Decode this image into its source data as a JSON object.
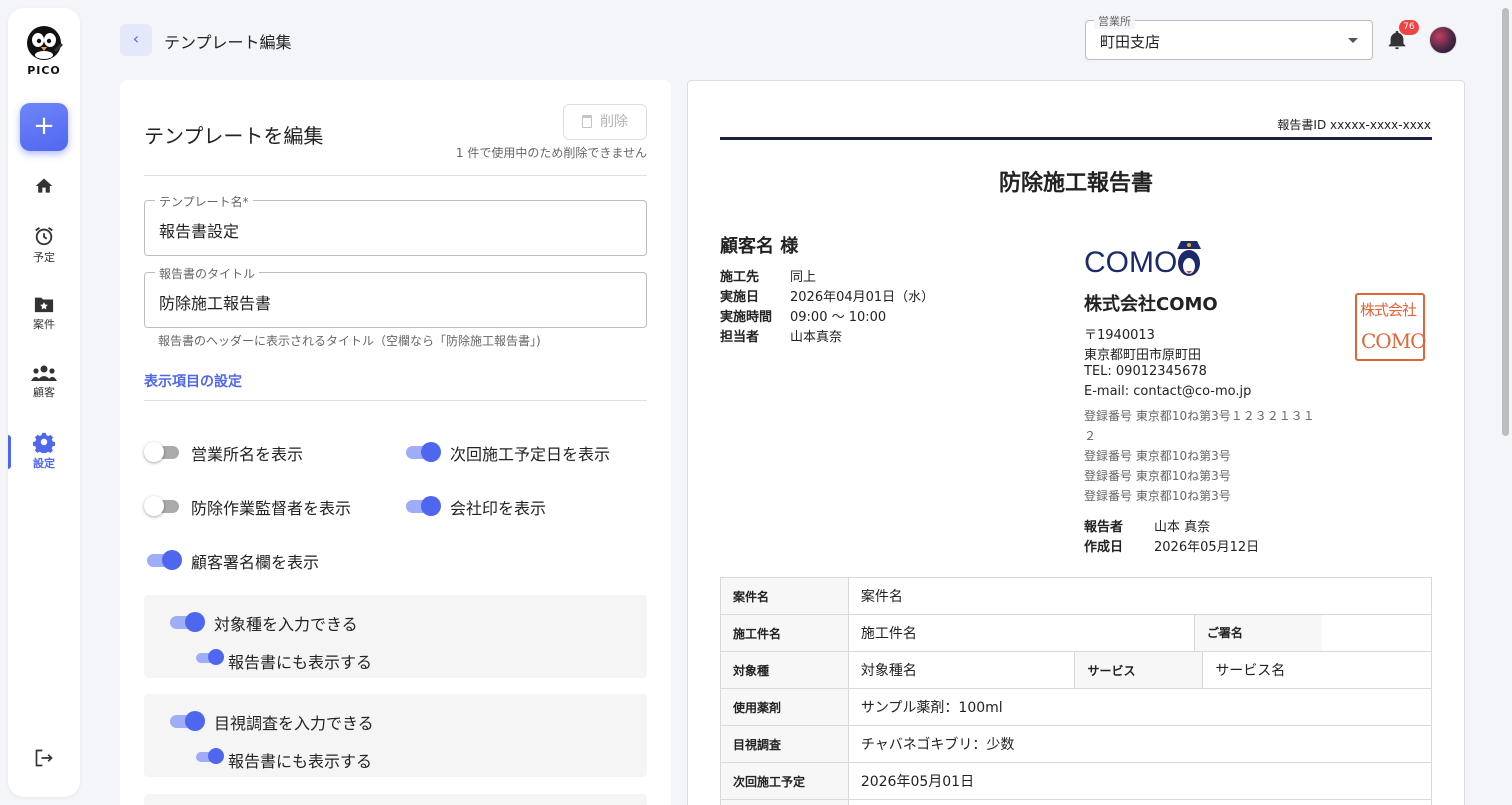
{
  "app": {
    "name": "PICO"
  },
  "sidebar": {
    "items": [
      {
        "label": "",
        "icon": "home-icon"
      },
      {
        "label": "予定",
        "icon": "alarm-clock-icon"
      },
      {
        "label": "案件",
        "icon": "folder-star-icon"
      },
      {
        "label": "顧客",
        "icon": "people-icon"
      },
      {
        "label": "設定",
        "icon": "gear-icon",
        "active": true
      }
    ],
    "logout_icon": "logout-icon"
  },
  "header": {
    "title": "テンプレート編集",
    "office_label": "営業所",
    "office_value": "町田支店",
    "notification_count": "76"
  },
  "form": {
    "title": "テンプレートを編集",
    "delete_label": "削除",
    "delete_note": "1 件で使用中のため削除できません",
    "template_name_label": "テンプレート名*",
    "template_name_value": "報告書設定",
    "report_title_label": "報告書のタイトル",
    "report_title_value": "防除施工報告書",
    "report_title_helper": "報告書のヘッダーに表示されるタイトル（空欄なら「防除施工報告書」)",
    "display_settings_link": "表示項目の設定",
    "toggles": [
      {
        "label": "営業所名を表示",
        "on": false
      },
      {
        "label": "次回施工予定日を表示",
        "on": true
      },
      {
        "label": "防除作業監督者を表示",
        "on": false
      },
      {
        "label": "会社印を表示",
        "on": true
      },
      {
        "label": "顧客署名欄を表示",
        "on": true
      }
    ],
    "groups": [
      {
        "label": "対象種を入力できる",
        "on": true,
        "sub_label": "報告書にも表示する",
        "sub_on": true
      },
      {
        "label": "目視調査を入力できる",
        "on": true,
        "sub_label": "報告書にも表示する",
        "sub_on": true
      }
    ]
  },
  "report": {
    "id_text": "報告書ID xxxxx-xxxx-xxxx",
    "title": "防除施工報告書",
    "customer": "顧客名 様",
    "info": [
      {
        "key": "施工先",
        "value": "同上"
      },
      {
        "key": "実施日",
        "value": "2026年04月01日（水）"
      },
      {
        "key": "実施時間",
        "value": "09:00 〜 10:00"
      },
      {
        "key": "担当者",
        "value": "山本真奈"
      }
    ],
    "company": {
      "logo_text": "COMO",
      "name": "株式会社COMO",
      "zip": "〒1940013",
      "address": "東京都町田市原町田",
      "tel": "TEL: 09012345678",
      "email": "E-mail: contact@co-mo.jp",
      "reg_numbers": [
        "登録番号 東京都10ね第3号１２３２１３１",
        "２",
        "登録番号 東京都10ね第3号",
        "登録番号 東京都10ね第3号",
        "登録番号 東京都10ね第3号"
      ],
      "seal_line1": "株式会社",
      "seal_line2": "COMO"
    },
    "reporter": [
      {
        "key": "報告者",
        "value": "山本 真奈"
      },
      {
        "key": "作成日",
        "value": "2026年05月12日"
      }
    ],
    "table": {
      "case_label": "案件名",
      "case_value": "案件名",
      "work_label": "施工件名",
      "work_value": "施工件名",
      "sign_label": "ご署名",
      "sign_value": "-",
      "target_label": "対象種",
      "target_value": "対象種名",
      "service_label": "サービス",
      "service_value": "サービス名",
      "chem_label": "使用薬剤",
      "chem_value": "サンプル薬剤：100ml",
      "visual_label": "目視調査",
      "visual_value": "チャバネゴキブリ：少数",
      "next_label": "次回施工予定",
      "next_value": "2026年05月01日"
    }
  },
  "colors": {
    "accent": "#4f67ef",
    "seal": "#e0663a",
    "navy": "#1b2140"
  }
}
